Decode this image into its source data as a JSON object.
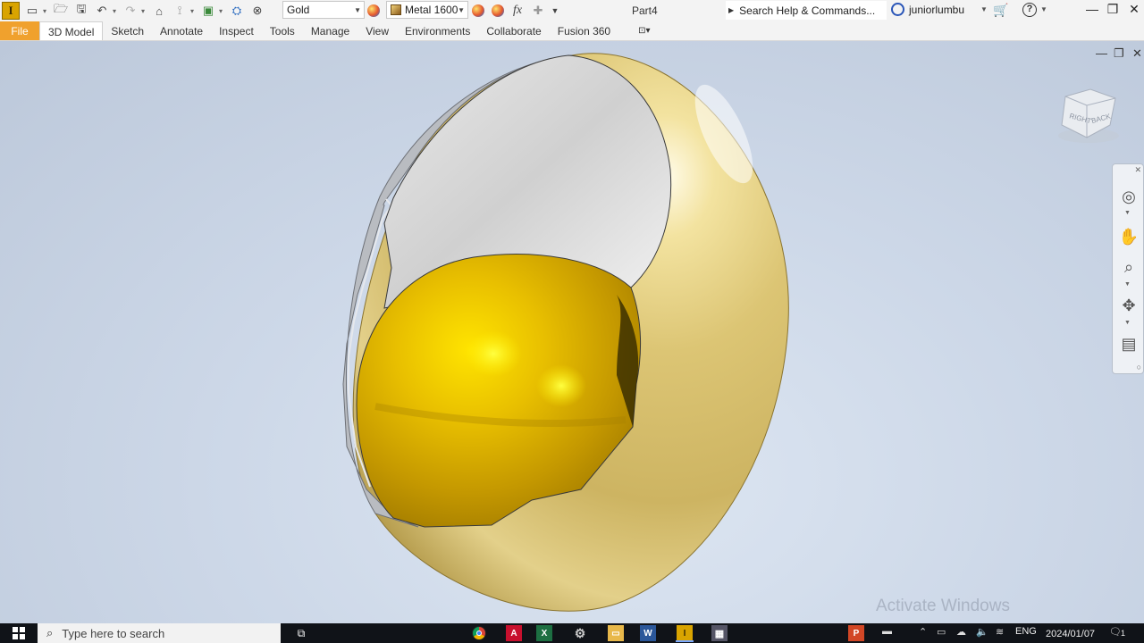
{
  "app": {
    "logo_letter": "I",
    "document_title": "Part4"
  },
  "toolbar": {
    "material_value": "Gold",
    "appearance_value": "Metal 1600",
    "fx_label": "fx"
  },
  "search": {
    "placeholder": "Search Help & Commands..."
  },
  "user": {
    "name": "juniorlumbu"
  },
  "tabs": [
    {
      "label": "File"
    },
    {
      "label": "3D Model"
    },
    {
      "label": "Sketch"
    },
    {
      "label": "Annotate"
    },
    {
      "label": "Inspect"
    },
    {
      "label": "Tools"
    },
    {
      "label": "Manage"
    },
    {
      "label": "View"
    },
    {
      "label": "Environments"
    },
    {
      "label": "Collaborate"
    },
    {
      "label": "Fusion 360"
    }
  ],
  "viewcube": {
    "face_right": "RIGHT",
    "face_back": "BACK"
  },
  "watermark": "Activate Windows",
  "taskbar": {
    "search_placeholder": "Type here to search",
    "language": "ENG",
    "date": "2024/01/07",
    "notification_count": "1"
  },
  "colors": {
    "file_tab": "#f0a12d",
    "gold_shell": "#d9c16a",
    "gold_sphere": "#e6bd00",
    "viewport_bg": "#cdd8e8",
    "taskbar_bg": "#101318"
  },
  "icons": [
    "new-file-icon",
    "open-icon",
    "save-icon",
    "undo-icon",
    "redo-icon",
    "home-icon",
    "measure-icon",
    "component-icon",
    "appearance-icon",
    "clear-appearance-icon",
    "fx-icon",
    "add-icon",
    "cart-icon",
    "help-icon",
    "orbit-icon",
    "pan-icon",
    "zoom-icon",
    "free-orbit-icon",
    "look-at-icon"
  ]
}
